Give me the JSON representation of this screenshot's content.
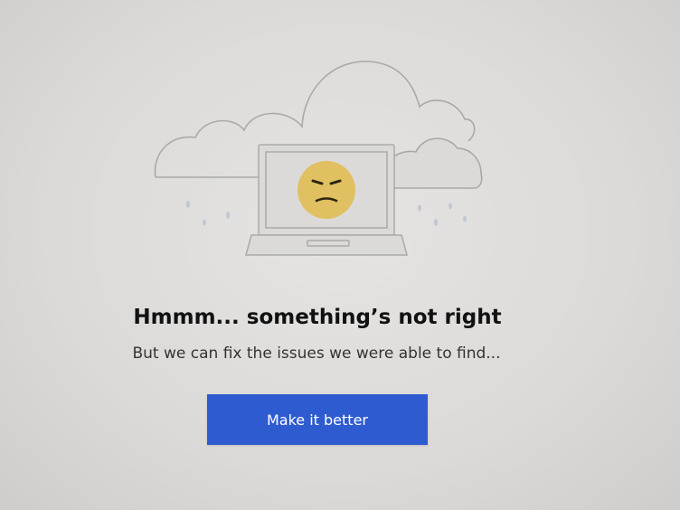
{
  "error_page": {
    "heading": "Hmmm... something’s not right",
    "message": "But we can fix the issues we were able to find...",
    "primary_button_label": "Make it better"
  },
  "illustration": {
    "icons": [
      "cloud-icon",
      "laptop-icon",
      "sad-face-icon",
      "raindrop-icon"
    ]
  },
  "colors": {
    "background": "#dcdad8",
    "button": "#2f5bd0",
    "button_text": "#ffffff",
    "face": "#e0c060",
    "line_art": "#a9a9a9"
  }
}
